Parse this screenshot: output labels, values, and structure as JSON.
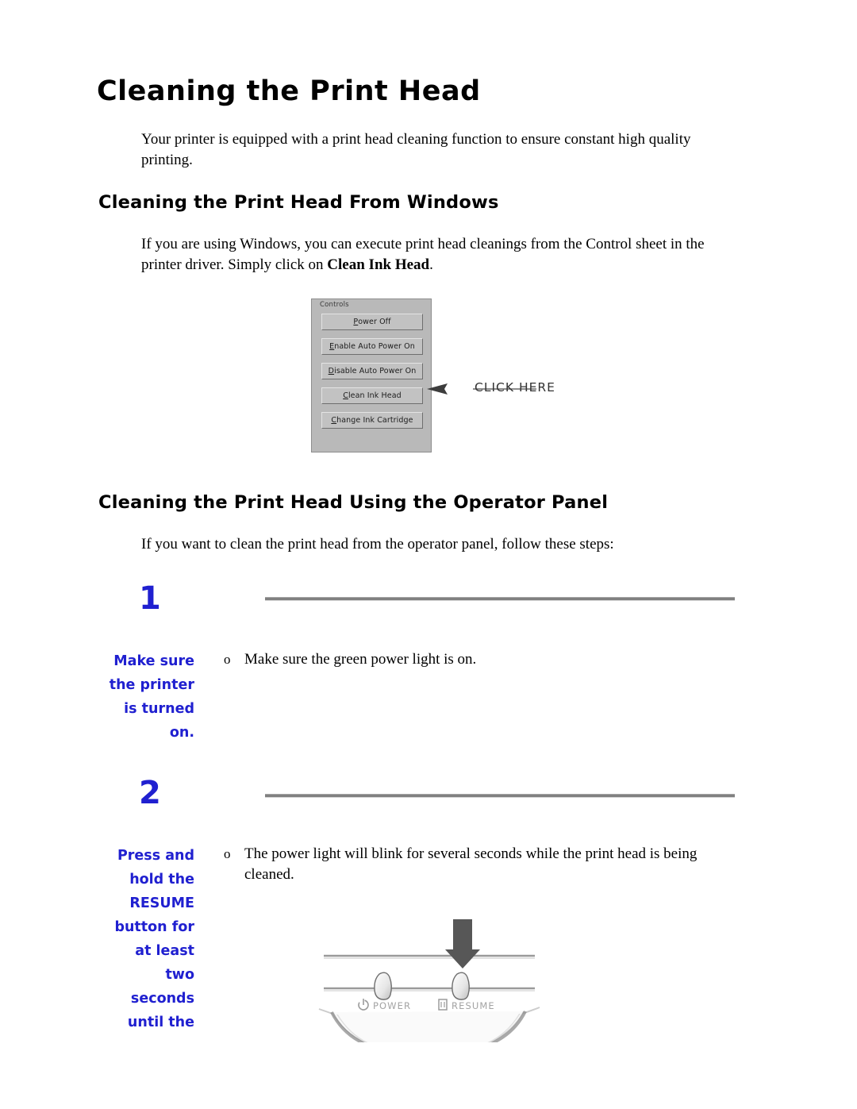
{
  "document": {
    "title": "Cleaning the Print Head",
    "intro_paragraph": "Your printer is equipped with a print head cleaning function to ensure constant high quality printing."
  },
  "section_windows": {
    "heading": "Cleaning the Print Head From Windows",
    "paragraph_before_bold": "If you are using Windows, you can execute print head cleanings from the Control sheet in the printer driver. Simply click on ",
    "bold_term": "Clean Ink Head",
    "paragraph_after_bold": "."
  },
  "dialog_figure": {
    "groupbox_label": "Controls",
    "buttons": [
      {
        "accel": "P",
        "rest": "ower Off",
        "full": "Power Off"
      },
      {
        "accel": "E",
        "rest": "nable Auto Power On",
        "full": "Enable Auto Power On"
      },
      {
        "accel": "D",
        "rest": "isable Auto Power On",
        "full": "Disable Auto Power On"
      },
      {
        "accel": "C",
        "rest": "lean Ink Head",
        "full": "Clean Ink Head"
      },
      {
        "accel": "C",
        "rest": "hange Ink Cartridge",
        "full": "Change Ink Cartridge"
      }
    ],
    "callout_label": "CLICK HERE",
    "callout_target": "Clean Ink Head"
  },
  "section_operator": {
    "heading": "Cleaning the Print Head Using the Operator Panel",
    "paragraph": "If you want to clean the print head from the operator panel, follow these steps:"
  },
  "steps": [
    {
      "number": "1",
      "side_note": "Make sure the printer is turned on.",
      "bullet_marker": "o",
      "bullet_text": "Make sure the green power light is on."
    },
    {
      "number": "2",
      "side_note": "Press and hold the RESUME button for at least two seconds until the",
      "bullet_marker": "o",
      "bullet_text": "The power light will blink for several seconds while the print head is being cleaned."
    }
  ],
  "panel_figure": {
    "power_label": "POWER",
    "resume_label": "RESUME",
    "power_icon": "power-symbol-icon",
    "resume_icon": "paper-sheet-icon",
    "arrow_icon": "down-arrow-icon"
  },
  "colors": {
    "step_blue": "#2020d0",
    "rule_gray": "#808080",
    "dialog_face": "#b9b9b9",
    "button_face": "#c2c2c2"
  }
}
